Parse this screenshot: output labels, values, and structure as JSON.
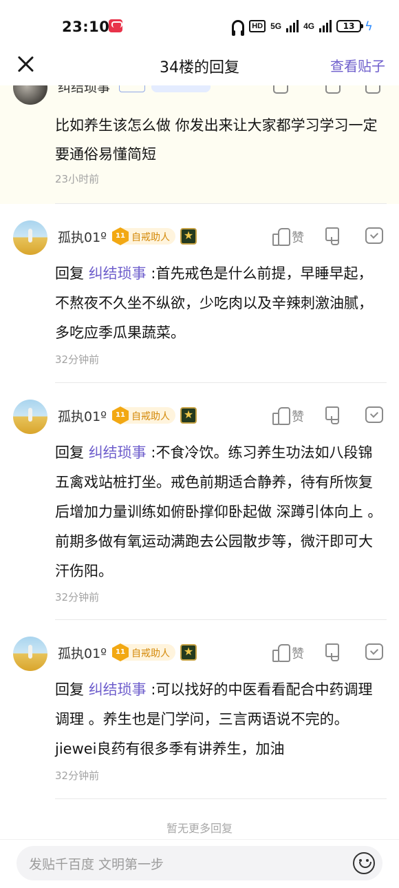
{
  "status_bar": {
    "time": "23:10",
    "hd_label": "HD",
    "net1": "5G",
    "net2": "4G",
    "battery": "13"
  },
  "nav": {
    "title": "34楼的回复",
    "view_post": "查看贴子"
  },
  "main_post": {
    "author": "纠结琐事",
    "content": "比如养生该怎么做 你发出来让大家都学习学习一定要通俗易懂简短",
    "time": "23小时前"
  },
  "replies": [
    {
      "author": "孤执01º",
      "level": "11",
      "badge": "自戒助人",
      "like_label": "赞",
      "reply_prefix": "回复",
      "mention": "纠结琐事",
      "text": ":首先戒色是什么前提，早睡早起，不熬夜不久坐不纵欲，少吃肉以及辛辣刺激油腻，多吃应季瓜果蔬菜。",
      "time": "32分钟前"
    },
    {
      "author": "孤执01º",
      "level": "11",
      "badge": "自戒助人",
      "like_label": "赞",
      "reply_prefix": "回复",
      "mention": "纠结琐事",
      "text": ":不食冷饮。练习养生功法如八段锦五禽戏站桩打坐。戒色前期适合静养，待有所恢复后增加力量训练如俯卧撑仰卧起做 深蹲引体向上 。前期多做有氧运动满跑去公园散步等，微汗即可大汗伤阳。",
      "time": "32分钟前"
    },
    {
      "author": "孤执01º",
      "level": "11",
      "badge": "自戒助人",
      "like_label": "赞",
      "reply_prefix": "回复",
      "mention": "纠结琐事",
      "text": ":可以找好的中医看看配合中药调理调理 。养生也是门学问，三言两语说不完的。jiewei良药有很多季有讲养生，加油",
      "time": "32分钟前"
    }
  ],
  "footer": {
    "no_more": "暂无更多回复",
    "input_placeholder": "发贴千百度 文明第一步"
  },
  "colors": {
    "accent": "#6e5ecc",
    "highlight_bg": "#fefdf2",
    "badge_text": "#d48a0b"
  }
}
